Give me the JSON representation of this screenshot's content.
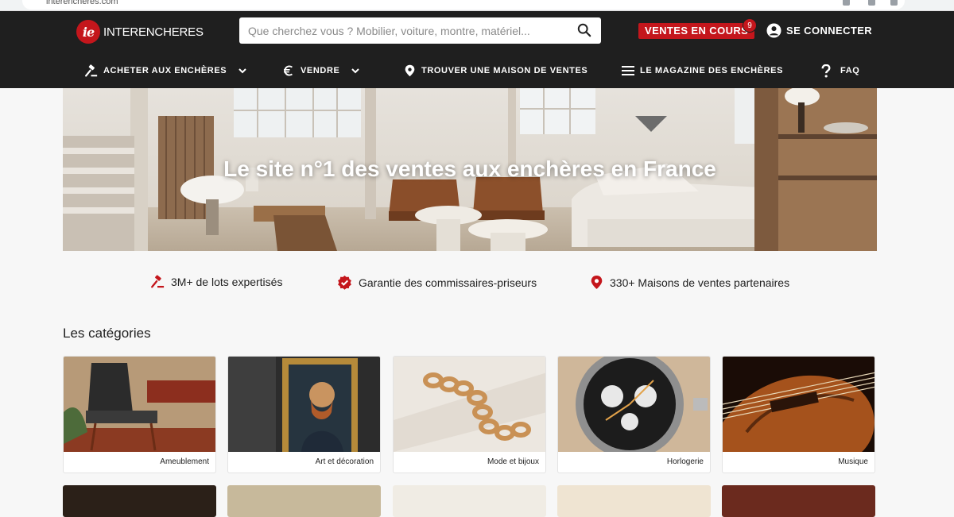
{
  "browser": {
    "url": "interencheres.com"
  },
  "brand": {
    "logo_mark": "ie",
    "name": "INTERENCHERES",
    "accent": "#c4161c",
    "nav_bg": "#1f1f1f"
  },
  "search": {
    "placeholder": "Que cherchez vous ? Mobilier, voiture, montre, matériel..."
  },
  "header": {
    "ventes_label": "VENTES EN COURS",
    "ventes_count": "9",
    "login_label": "SE CONNECTER"
  },
  "menu": [
    {
      "label": "ACHETER AUX ENCHÈRES",
      "icon": "gavel-icon"
    },
    {
      "label": "VENDRE",
      "icon": "euro-icon"
    },
    {
      "label": "TROUVER UNE MAISON DE VENTES",
      "icon": "location-pin-icon"
    },
    {
      "label": "LE MAGAZINE DES ENCHÈRES",
      "icon": "hamburger-icon"
    },
    {
      "label": "FAQ",
      "icon": "question-icon"
    }
  ],
  "hero": {
    "title": "Le site n°1 des ventes aux enchères en France"
  },
  "features": [
    {
      "label": "3M+ de lots expertisés",
      "icon": "gavel-icon"
    },
    {
      "label": "Garantie des commissaires-priseurs",
      "icon": "certified-check-icon"
    },
    {
      "label": "330+ Maisons de ventes partenaires",
      "icon": "location-pin-icon"
    }
  ],
  "categories": {
    "title": "Les catégories",
    "items": [
      {
        "label": "Ameublement"
      },
      {
        "label": "Art et décoration"
      },
      {
        "label": "Mode et bijoux"
      },
      {
        "label": "Horlogerie"
      },
      {
        "label": "Musique"
      }
    ]
  }
}
